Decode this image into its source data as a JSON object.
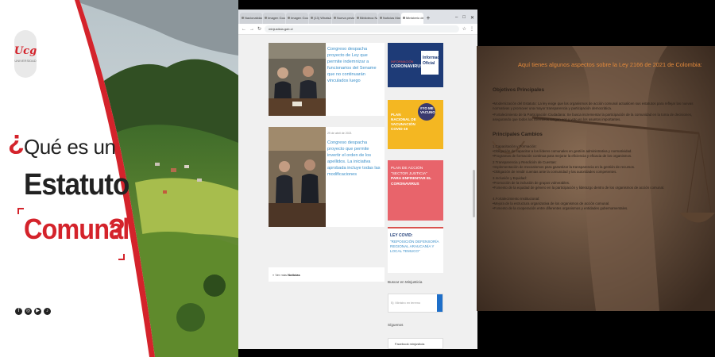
{
  "left": {
    "logo_text": "Ucg",
    "logo_sub": "UNIVERSIDAD",
    "title_q": "¿",
    "title_line1": "Qué es un",
    "title_line2": "Estatuto",
    "title_line3": "Comunal",
    "title_qend": "?",
    "social_icons": [
      "facebook-icon",
      "instagram-icon",
      "youtube-icon",
      "tiktok-icon"
    ],
    "social_glyphs": [
      "f",
      "◎",
      "▶",
      "♪"
    ]
  },
  "browser": {
    "tabs": [
      "Nacionalidad | MI",
      "Imagen Google",
      "Imagen Google",
      "(13) WhatsApp",
      "Nueva pestaña",
      "Biblioteca Nac",
      "Noticias Mars",
      "Ministerio de J"
    ],
    "active_tab": 7,
    "new_tab": "+",
    "window_controls": [
      "–",
      "□",
      "✕"
    ],
    "url": "minjusticia.gob.cl",
    "news": [
      {
        "date": "",
        "text": "Congreso despacha proyecto de Ley que permite indemnizar a funcionarios del Sename que no continuarán vinculados luego"
      },
      {
        "date": "29 de abril de 2021",
        "text": "Congreso despacha proyecto que permite invertir el orden de los apellidos. La iniciativa aprobada incluye todas las modificaciones"
      }
    ],
    "more_label": "« Ver más",
    "more_bold": "Noticias",
    "banners": {
      "b1_line1": "INFORMACIÓN",
      "b1_line2": "CORONAVIRUS",
      "b1_sq": "Información Oficial",
      "b2_text": "PLAN NACIONAL DE VACUNACIÓN COVID-19",
      "b2_circle": "#YO ME VACUNO",
      "b3_text": "PLAN DE ACCIÓN",
      "b3_text2": "\"SECTOR JUSTICIA\"",
      "b3_bold": "PARA ENFRENTAR EL CORONAVIRUS",
      "b4_head": "LEY COVID:",
      "b4_text": "\"REPOSICIÓN DEFENSORÍA REGIONAL ARAUCANÍA Y LOCAL TEMUCO\""
    },
    "search_label": "Buscar en Minjusticia",
    "search_placeholder": "Ej: Ministro en terreno",
    "follow_label": "Síguenos",
    "fb_label": "Facebook   minjusticia"
  },
  "right": {
    "title": "Aquí tienes algunos aspectos sobre la Ley 2166 de 2021 de Colombia:",
    "h_objectives": "Objetivos Principales",
    "obj1": "•Modernización del Estatuto: La ley exige que los organismos de acción comunal actualicen sus estatutos para reflejar las nuevas normativas y promover una mayor transparencia y participación democrática.",
    "obj2": "•Fortalecimiento de la Participación Ciudadana: Se busca incrementar la participación de la comunidad en la toma de decisiones, asegurando que todos los miembros tengan voz y voto en los asuntos importantes.",
    "h_changes": "Principales Cambios",
    "changes": [
      "1.Capacitación y Formación:",
      "   •Obligación de capacitar a los líderes comunales en gestión administrativa y normatividad.",
      "   •Programas de formación continua para mejorar la eficiencia y eficacia de los organismos.",
      "2.Transparencia y Rendición de Cuentas:",
      "   •Implementación de mecanismos para garantizar la transparencia en la gestión de recursos.",
      "   •Obligación de rendir cuentas ante la comunidad y las autoridades competentes.",
      "3.Inclusión y Equidad:",
      "   •Promoción de la inclusión de grupos vulnerables.",
      "   •Fomento de la equidad de género en la participación y liderazgo dentro de los organismos de acción comunal.",
      "4.Fortalecimiento Institucional:",
      "   •Mejora de la estructura organizativa de los organismos de acción comunal.",
      "   •Fomento de la cooperación entre diferentes organismos y entidades gubernamentales."
    ]
  }
}
